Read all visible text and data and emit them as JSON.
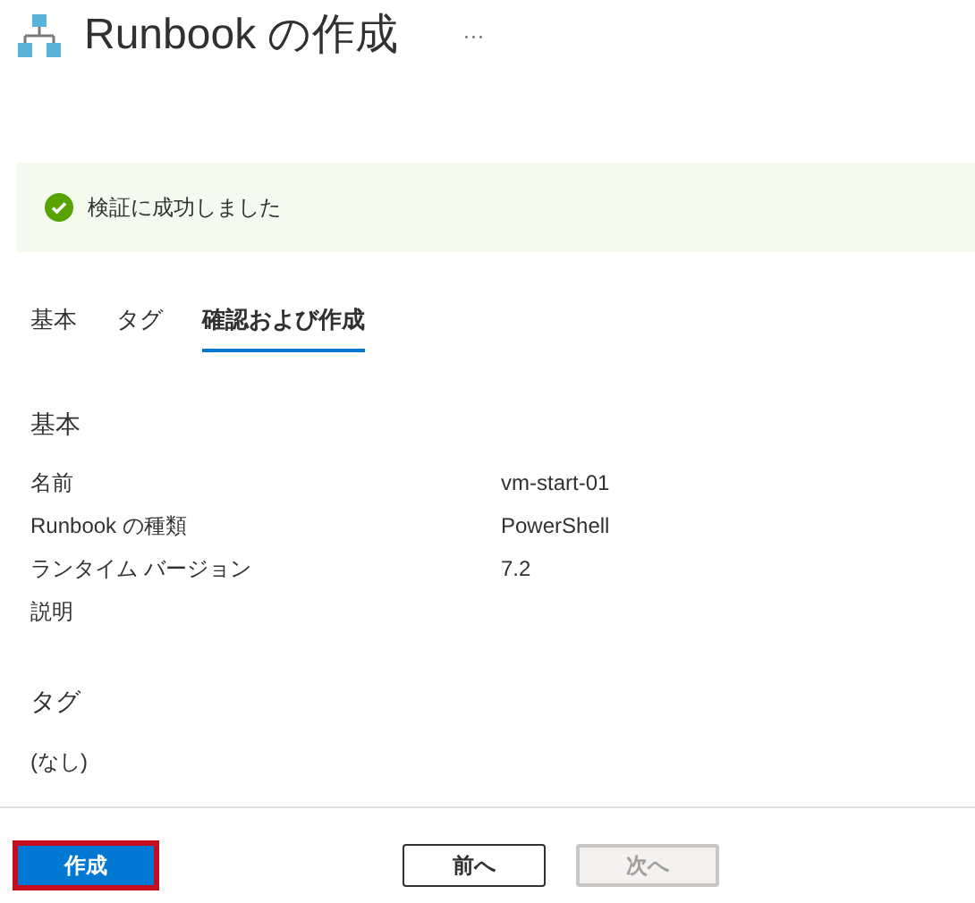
{
  "title": "Runbook の作成",
  "more": "···",
  "banner": {
    "message": "検証に成功しました"
  },
  "tabs": [
    {
      "label": "基本",
      "selected": false
    },
    {
      "label": "タグ",
      "selected": false
    },
    {
      "label": "確認および作成",
      "selected": true
    }
  ],
  "sections": [
    {
      "heading": "基本",
      "rows": [
        {
          "label": "名前",
          "value": "vm-start-01"
        },
        {
          "label": "Runbook の種類",
          "value": "PowerShell"
        },
        {
          "label": "ランタイム バージョン",
          "value": "7.2"
        },
        {
          "label": "説明"
        }
      ]
    },
    {
      "heading": "タグ",
      "note": "(なし)"
    }
  ],
  "buttons": [
    {
      "label": "作成",
      "kind": "primary",
      "highlighted": true,
      "disabled": false
    },
    {
      "label": "前へ",
      "kind": "secondary",
      "highlighted": false,
      "disabled": false
    },
    {
      "label": "次へ",
      "kind": "secondary",
      "highlighted": false,
      "disabled": true
    }
  ]
}
